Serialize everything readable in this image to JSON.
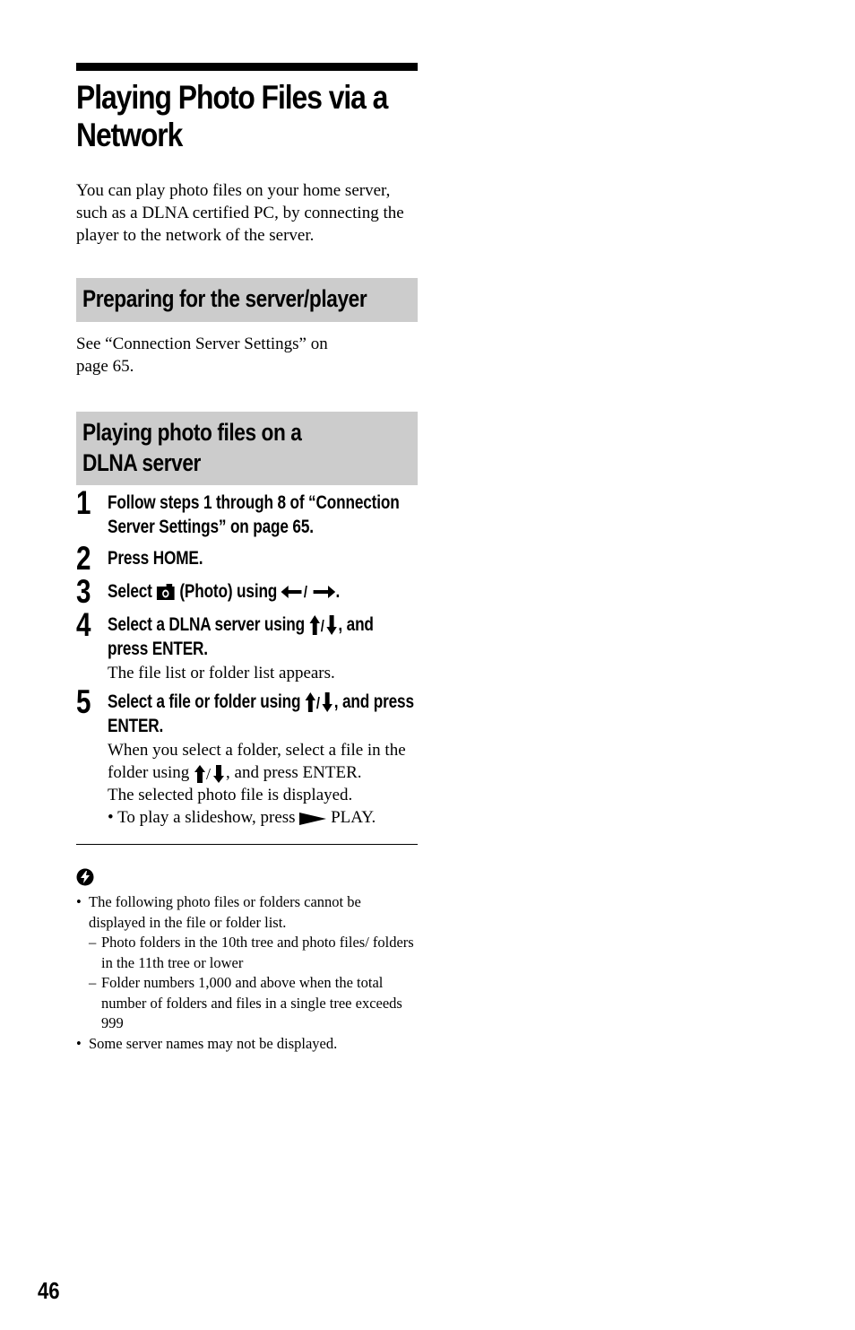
{
  "title": "Playing Photo Files via a Network",
  "intro": "You can play photo files on your home server, such as a DLNA certified PC, by connecting the player to the network of the server.",
  "section1": {
    "heading": "Preparing for the server/player",
    "body": "See “Connection Server Settings” on page 65."
  },
  "section2": {
    "heading": "Playing photo files on a DLNA server",
    "steps": [
      {
        "num": "1",
        "head": "Follow steps 1 through 8 of “Connection Server Settings” on page 65."
      },
      {
        "num": "2",
        "head": "Press HOME."
      },
      {
        "num": "3",
        "head_pre": "Select",
        "head_icon": "camera-icon",
        "head_mid": "(Photo) using",
        "head_icon2": "left-right-arrows-icon",
        "head_post": "."
      },
      {
        "num": "4",
        "head_pre": "Select a DLNA server using",
        "head_icon": "up-down-arrows-icon",
        "head_post": ", and press ENTER.",
        "body": "The file list or folder list appears."
      },
      {
        "num": "5",
        "head_pre": "Select a file or folder using",
        "head_icon": "up-down-arrows-icon",
        "head_post": ", and press ENTER.",
        "body1_pre": "When you select a folder, select a file in the folder using",
        "body1_icon": "up-down-arrows-icon",
        "body1_post": ", and press ENTER.",
        "body2": "The selected photo file is displayed.",
        "bullet_pre": "To play a slideshow, press",
        "bullet_icon": "play-icon",
        "bullet_post": "PLAY."
      }
    ]
  },
  "notes": {
    "icon": "tip-icon",
    "items": [
      {
        "text": "The following photo files or folders cannot be displayed in the file or folder list.",
        "subs": [
          "Photo folders in the 10th tree and photo files/ folders in the 11th tree or lower",
          "Folder numbers 1,000 and above when the total number of folders and files in a single tree exceeds 999"
        ]
      },
      {
        "text": "Some server names may not be displayed."
      }
    ],
    "bullet": "•",
    "dash": "–"
  },
  "page_number": "46"
}
